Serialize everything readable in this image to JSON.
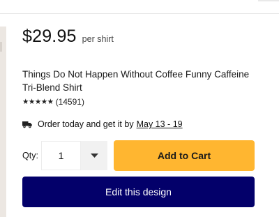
{
  "product": {
    "price": "$29.95",
    "per_unit": "per shirt",
    "title": "Things Do Not Happen Without Coffee Funny Caffeine Tri-Blend Shirt",
    "rating": {
      "stars_text": "★★★★★",
      "stars_value": 4.5,
      "count": "(14591)"
    }
  },
  "shipping": {
    "icon": "truck-icon",
    "text": "Order today and get it by",
    "date": "May 13 - 19"
  },
  "purchase": {
    "qty_label": "Qty:",
    "qty_value": "1",
    "add_to_cart_label": "Add to Cart",
    "edit_design_label": "Edit this design"
  },
  "colors": {
    "add_to_cart_bg": "#ffb630",
    "edit_design_bg": "#03006a"
  }
}
